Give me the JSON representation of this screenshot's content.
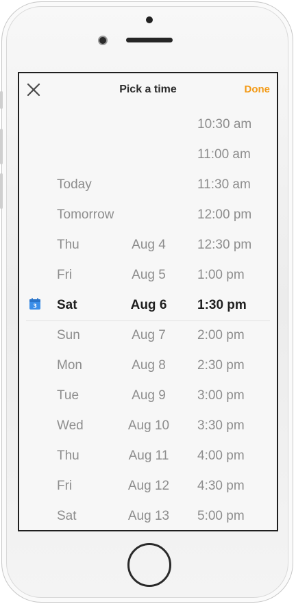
{
  "header": {
    "close_icon": "close-icon",
    "title": "Pick a time",
    "done_label": "Done"
  },
  "colors": {
    "accent": "#f39a16",
    "calendar_icon": "#3b8ee8",
    "text_selected": "#1e1e1e",
    "text_muted": "#8d8d8d"
  },
  "picker": {
    "selected_index": 6,
    "selected_icon": "calendar-icon",
    "calendar_icon_number": "3",
    "rows": [
      {
        "day": "",
        "date": "",
        "time": "10:30 am"
      },
      {
        "day": "",
        "date": "",
        "time": "11:00 am"
      },
      {
        "day": "Today",
        "date": "",
        "time": "11:30 am"
      },
      {
        "day": "Tomorrow",
        "date": "",
        "time": "12:00 pm"
      },
      {
        "day": "Thu",
        "date": "Aug 4",
        "time": "12:30 pm"
      },
      {
        "day": "Fri",
        "date": "Aug 5",
        "time": "1:00 pm"
      },
      {
        "day": "Sat",
        "date": "Aug 6",
        "time": "1:30 pm"
      },
      {
        "day": "Sun",
        "date": "Aug 7",
        "time": "2:00 pm"
      },
      {
        "day": "Mon",
        "date": "Aug 8",
        "time": "2:30 pm"
      },
      {
        "day": "Tue",
        "date": "Aug 9",
        "time": "3:00 pm"
      },
      {
        "day": "Wed",
        "date": "Aug 10",
        "time": "3:30 pm"
      },
      {
        "day": "Thu",
        "date": "Aug 11",
        "time": "4:00 pm"
      },
      {
        "day": "Fri",
        "date": "Aug 12",
        "time": "4:30 pm"
      },
      {
        "day": "Sat",
        "date": "Aug 13",
        "time": "5:00 pm"
      }
    ]
  }
}
